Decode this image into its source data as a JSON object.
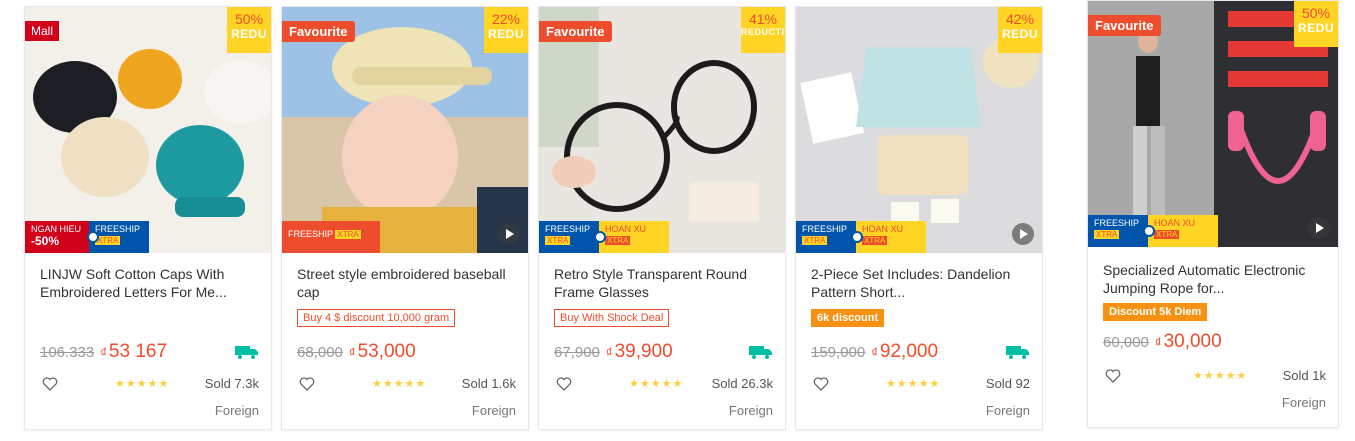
{
  "colors": {
    "accent": "#ee4d2d",
    "discount_yellow": "#ffd424",
    "freeship_blue": "#0055aa",
    "mall_red": "#d0011b",
    "free_ship_truck": "#00bfa5"
  },
  "products": [
    {
      "badge": "Mall",
      "discount_pct": "50%",
      "discount_word": "REDU",
      "ribbon_left_line1": "NGAN HIEU",
      "ribbon_left_line2": "-50%",
      "ribbon_right_line1": "FREESHIP",
      "ribbon_right_line2": "XTRA",
      "title": "LINJW Soft Cotton Caps With Embroidered Letters For Me...",
      "old_price": "106.333",
      "currency": "₫",
      "new_price": "53 167",
      "stars": "★★★★★",
      "sold": "Sold 7.3k",
      "origin": "Foreign"
    },
    {
      "badge": "Favourite",
      "discount_pct": "22%",
      "discount_word": "REDU",
      "ribbon_left_line1": "FREESHIP",
      "ribbon_left_line2": "XTRA",
      "title": "Street style embroidered baseball cap",
      "promo": "Buy 4 $ discount 10,000 gram",
      "old_price": "68,000",
      "currency": "₫",
      "new_price": "53,000",
      "stars": "★★★★★",
      "sold": "Sold 1.6k",
      "origin": "Foreign"
    },
    {
      "badge": "Favourite",
      "discount_pct": "41%",
      "discount_word": "REDUCTION",
      "ribbon_left_line1": "FREESHIP",
      "ribbon_left_line2": "XTRA",
      "ribbon_right_line1": "HOAN XU",
      "ribbon_right_line2": "XTRA",
      "title": "Retro Style Transparent Round Frame Glasses",
      "promo": "Buy With Shock Deal",
      "old_price": "67,900",
      "currency": "₫",
      "new_price": "39,900",
      "stars": "★★★★★",
      "sold": "Sold 26.3k",
      "origin": "Foreign"
    },
    {
      "discount_pct": "42%",
      "discount_word": "REDU",
      "ribbon_left_line1": "FREESHIP",
      "ribbon_left_line2": "XTRA",
      "ribbon_right_line1": "HOAN XU",
      "ribbon_right_line2": "XTRA",
      "title": "2-Piece Set Includes: Dandelion Pattern Short...",
      "promo": "6k discount",
      "old_price": "159,000",
      "currency": "₫",
      "new_price": "92,000",
      "stars": "★★★★★",
      "sold": "Sold 92",
      "origin": "Foreign"
    },
    {
      "badge": "Favourite",
      "discount_pct": "50%",
      "discount_word": "REDU",
      "ribbon_left_line1": "FREESHIP",
      "ribbon_left_line2": "XTRA",
      "ribbon_right_line1": "HOAN XU",
      "ribbon_right_line2": "XTRA",
      "title": "Specialized Automatic Electronic Jumping Rope for...",
      "promo": "Discount 5k Diem",
      "old_price": "60,000",
      "currency": "₫",
      "new_price": "30,000",
      "stars": "★★★★★",
      "sold": "Sold 1k",
      "origin": "Foreign"
    }
  ]
}
